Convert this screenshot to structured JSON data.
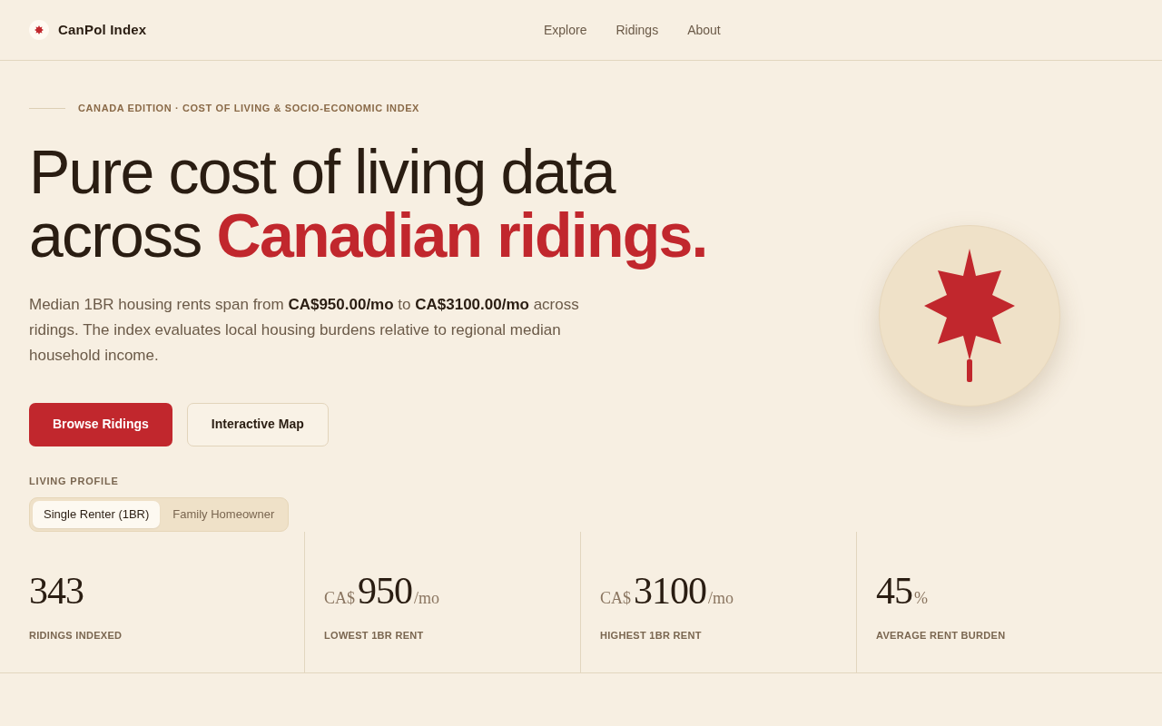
{
  "header": {
    "brand": "CanPol Index",
    "nav": [
      {
        "label": "Explore"
      },
      {
        "label": "Ridings"
      },
      {
        "label": "About"
      }
    ]
  },
  "hero": {
    "eyebrow": "CANADA EDITION · COST OF LIVING & SOCIO-ECONOMIC INDEX",
    "headline": "Pure cost of living data across **Canadian ridings.**",
    "description": "Median 1BR housing rents span from **CA$950.00/mo** to **CA$3100.00/mo** across ridings. The index evaluates local housing burdens relative to regional median household income.",
    "buttons": [
      {
        "label": "Browse Ridings",
        "kind": "primary"
      },
      {
        "label": "Interactive Map",
        "kind": "secondary"
      }
    ]
  },
  "profile": {
    "label": "LIVING PROFILE",
    "options": [
      {
        "label": "Single Renter (1BR)",
        "selected": true
      },
      {
        "label": "Family Homeowner",
        "selected": false
      }
    ]
  },
  "stats": [
    {
      "value": "343",
      "label": "RIDINGS INDEXED"
    },
    {
      "prefix": "CA$",
      "value": "950",
      "suffix": "/mo",
      "label": "LOWEST 1BR RENT"
    },
    {
      "prefix": "CA$",
      "value": "3100",
      "suffix": "/mo",
      "label": "HIGHEST 1BR RENT"
    },
    {
      "value": "45",
      "suffix": "%",
      "label": "AVERAGE RENT BURDEN"
    }
  ]
}
